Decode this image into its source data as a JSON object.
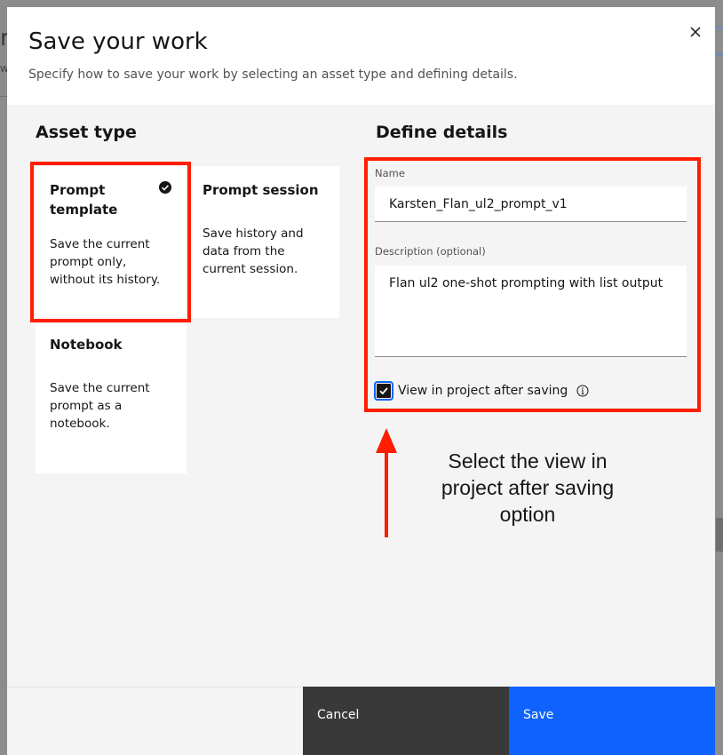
{
  "modal": {
    "title": "Save your work",
    "subtitle": "Specify how to save your work by selecting an asset type and defining details."
  },
  "asset_type": {
    "heading": "Asset type",
    "tiles": [
      {
        "title": "Prompt template",
        "description": "Save the current prompt only, without its history.",
        "selected": true
      },
      {
        "title": "Prompt session",
        "description": "Save history and data from the current session.",
        "selected": false
      },
      {
        "title": "Notebook",
        "description": "Save the current prompt as a notebook.",
        "selected": false
      }
    ]
  },
  "details": {
    "heading": "Define details",
    "name_label": "Name",
    "name_value": "Karsten_Flan_ul2_prompt_v1",
    "description_label": "Description (optional)",
    "description_value": "Flan ul2 one-shot prompting with list output",
    "checkbox_label": "View in project after saving",
    "checkbox_checked": true
  },
  "annotation": {
    "text": "Select the view in project after saving option",
    "color": "#ff1e00"
  },
  "footer": {
    "cancel_label": "Cancel",
    "save_label": "Save"
  },
  "background": {
    "fragment": "ro",
    "fragment2": "w"
  },
  "colors": {
    "primary": "#0f62fe",
    "secondary": "#393939",
    "highlight": "#ff1e00"
  }
}
